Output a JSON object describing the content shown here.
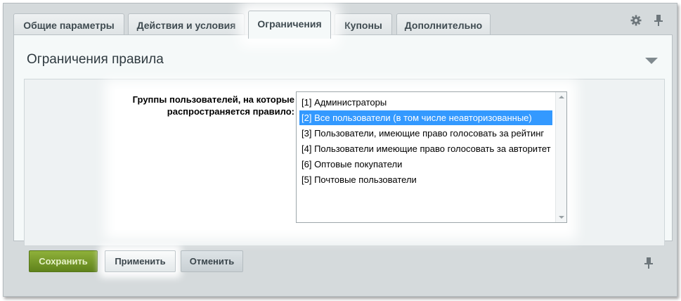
{
  "tabs": [
    {
      "label": "Общие параметры"
    },
    {
      "label": "Действия и условия"
    },
    {
      "label": "Ограничения"
    },
    {
      "label": "Купоны"
    },
    {
      "label": "Дополнительно"
    }
  ],
  "active_tab": "Ограничения",
  "panel": {
    "title": "Ограничения правила"
  },
  "field": {
    "label_line1": "Группы пользователей, на которые",
    "label_line2": "распространяется правило:"
  },
  "groups": [
    {
      "label": "[1] Администраторы",
      "selected": false
    },
    {
      "label": "[2] Все пользователи (в том числе неавторизованные)",
      "selected": true
    },
    {
      "label": "[3] Пользователи, имеющие право голосовать за рейтинг",
      "selected": false
    },
    {
      "label": "[4] Пользователи имеющие право голосовать за авторитет",
      "selected": false
    },
    {
      "label": "[6] Оптовые покупатели",
      "selected": false
    },
    {
      "label": "[5] Почтовые пользователи",
      "selected": false
    }
  ],
  "buttons": {
    "save": "Сохранить",
    "apply": "Применить",
    "cancel": "Отменить"
  },
  "icons": {
    "settings": "gear-icon",
    "pin": "pin-icon",
    "collapse": "triangle-down-icon"
  },
  "colors": {
    "selection": "#3399ff",
    "save_button": "#6e9124"
  }
}
